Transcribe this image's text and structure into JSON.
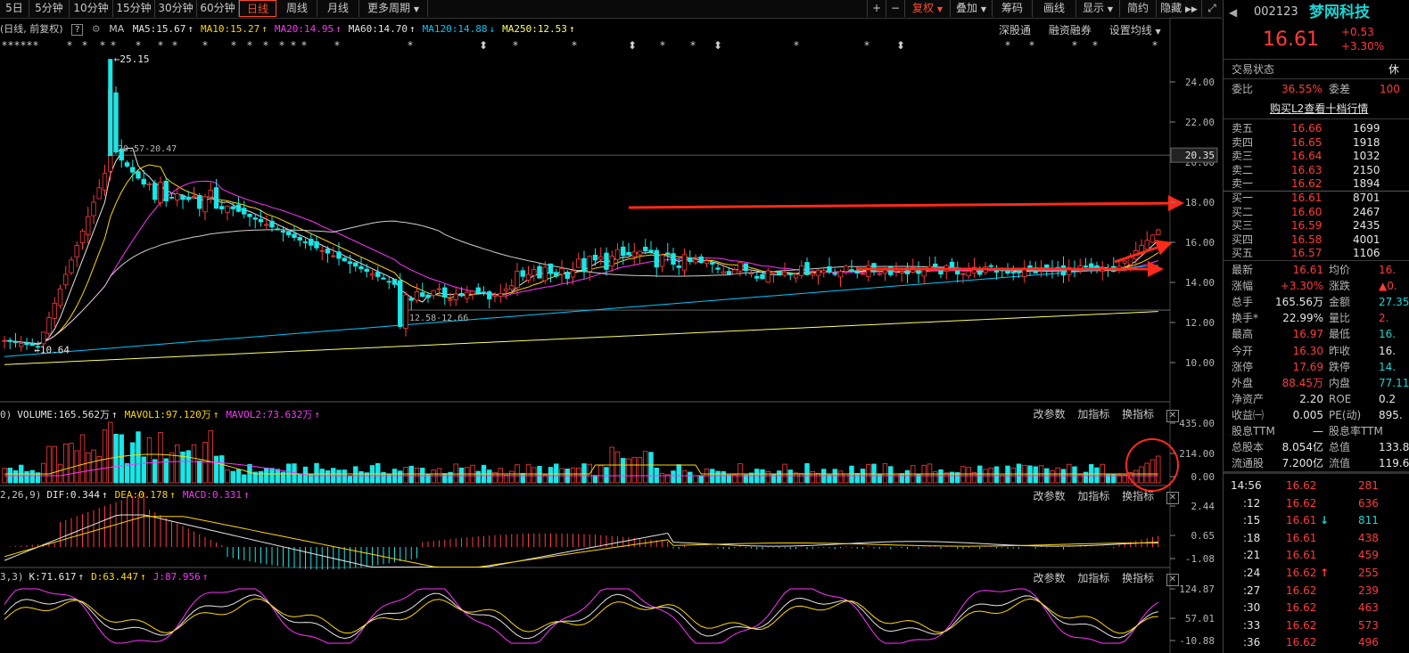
{
  "toolbar": {
    "periods": [
      "5日",
      "5分钟",
      "10分钟",
      "15分钟",
      "30分钟",
      "60分钟",
      "日线",
      "周线",
      "月线",
      "更多周期"
    ],
    "active_period": "日线",
    "right_buttons": [
      "+",
      "−",
      "复权",
      "叠加",
      "筹码",
      "画线",
      "显示",
      "简约",
      "隐藏"
    ]
  },
  "main_chart": {
    "header": "(日线, 前复权)",
    "ma_label": "MA",
    "ma": [
      {
        "text": "MA5:15.67",
        "color": "#e6e6e6",
        "arrow": "↑"
      },
      {
        "text": "MA10:15.27",
        "color": "#ffd700",
        "arrow": "↑"
      },
      {
        "text": "MA20:14.95",
        "color": "#ff33ff",
        "arrow": "↑"
      },
      {
        "text": "MA60:14.70",
        "color": "#e6e6e6",
        "arrow": "↑"
      },
      {
        "text": "MA120:14.88",
        "color": "#00c8ff",
        "arrow": "↓"
      },
      {
        "text": "MA250:12.53",
        "color": "#ffff66",
        "arrow": "↑"
      }
    ],
    "links": [
      "深股通",
      "融资融券",
      "设置均线"
    ],
    "y_ticks": [
      "24.00",
      "22.00",
      "20.00",
      "18.00",
      "16.00",
      "14.00",
      "12.00",
      "10.00"
    ],
    "ref_price": "20.35",
    "annotations": {
      "high": "←25.15",
      "low": "←10.64",
      "range1": "20.57-20.47",
      "range2": "12.58-12.66"
    }
  },
  "volume_panel": {
    "prefix": "0)",
    "items": [
      {
        "text": "VOLUME:165.562万",
        "color": "#e6e6e6",
        "arrow": "↑"
      },
      {
        "text": "MAVOL1:97.120万",
        "color": "#ffd700",
        "arrow": "↑"
      },
      {
        "text": "MAVOL2:73.632万",
        "color": "#ff33ff",
        "arrow": "↑"
      }
    ],
    "y_ticks": [
      "435.00",
      "214.00",
      "0.00"
    ]
  },
  "macd_panel": {
    "prefix": "2,26,9)",
    "items": [
      {
        "text": "DIF:0.344",
        "color": "#e6e6e6",
        "arrow": "↑"
      },
      {
        "text": "DEA:0.178",
        "color": "#ffd700",
        "arrow": "↑"
      },
      {
        "text": "MACD:0.331",
        "color": "#ff33ff",
        "arrow": "↑"
      }
    ],
    "y_ticks": [
      "2.44",
      "0.65",
      "-1.08"
    ]
  },
  "kdj_panel": {
    "prefix": "3,3)",
    "items": [
      {
        "text": "K:71.617",
        "color": "#e6e6e6",
        "arrow": "↑"
      },
      {
        "text": "D:63.447",
        "color": "#ffd700",
        "arrow": "↑"
      },
      {
        "text": "J:87.956",
        "color": "#ff33ff",
        "arrow": "↑"
      }
    ],
    "y_ticks": [
      "124.87",
      "57.01",
      "-10.88"
    ]
  },
  "panel_buttons": [
    "改参数",
    "加指标",
    "换指标"
  ],
  "stock": {
    "code": "002123",
    "name": "梦网科技",
    "price": "16.61",
    "change": "+0.53",
    "change_pct": "+3.30%"
  },
  "trade_status": {
    "label": "交易状态",
    "value": "休"
  },
  "weibi": {
    "label1": "委比",
    "value1": "36.55%",
    "label2": "委差",
    "value2": "100"
  },
  "l2_link": "购买L2查看十档行情",
  "sell_orders": [
    {
      "label": "卖五",
      "price": "16.66",
      "vol": "1699"
    },
    {
      "label": "卖四",
      "price": "16.65",
      "vol": "1918"
    },
    {
      "label": "卖三",
      "price": "16.64",
      "vol": "1032"
    },
    {
      "label": "卖二",
      "price": "16.63",
      "vol": "2150"
    },
    {
      "label": "卖一",
      "price": "16.62",
      "vol": "1894"
    }
  ],
  "buy_orders": [
    {
      "label": "买一",
      "price": "16.61",
      "vol": "8701"
    },
    {
      "label": "买二",
      "price": "16.60",
      "vol": "2467"
    },
    {
      "label": "买三",
      "price": "16.59",
      "vol": "2435"
    },
    {
      "label": "买四",
      "price": "16.58",
      "vol": "4001"
    },
    {
      "label": "买五",
      "price": "16.57",
      "vol": "1106"
    }
  ],
  "stats": [
    {
      "l1": "最新",
      "v1": "16.61",
      "c1": "red",
      "l2": "均价",
      "v2": "16.",
      "c2": "red"
    },
    {
      "l1": "涨幅",
      "v1": "+3.30%",
      "c1": "red",
      "l2": "涨跌",
      "v2": "▲0.",
      "c2": "red"
    },
    {
      "l1": "总手",
      "v1": "165.56万",
      "c1": "white",
      "l2": "金额",
      "v2": "27.35",
      "c2": "green"
    },
    {
      "l1": "换手*",
      "v1": "22.99%",
      "c1": "white",
      "l2": "量比",
      "v2": "2.",
      "c2": "red"
    },
    {
      "l1": "最高",
      "v1": "16.97",
      "c1": "red",
      "l2": "最低",
      "v2": "16.",
      "c2": "green"
    },
    {
      "l1": "今开",
      "v1": "16.30",
      "c1": "red",
      "l2": "昨收",
      "v2": "16.",
      "c2": "white"
    },
    {
      "l1": "涨停",
      "v1": "17.69",
      "c1": "red",
      "l2": "跌停",
      "v2": "14.",
      "c2": "green"
    },
    {
      "l1": "外盘",
      "v1": "88.45万",
      "c1": "red",
      "l2": "内盘",
      "v2": "77.11",
      "c2": "green"
    },
    {
      "l1": "净资产",
      "v1": "2.20",
      "c1": "white",
      "l2": "ROE",
      "v2": "0.2",
      "c2": "white"
    },
    {
      "l1": "收益㈠",
      "v1": "0.005",
      "c1": "white",
      "l2": "PE(动)",
      "v2": "895.",
      "c2": "white"
    },
    {
      "l1": "股息TTM",
      "v1": "—",
      "c1": "white",
      "l2": "股息率TTM",
      "v2": "",
      "c2": "white"
    },
    {
      "l1": "总股本",
      "v1": "8.054亿",
      "c1": "white",
      "l2": "总值",
      "v2": "133.8",
      "c2": "white"
    },
    {
      "l1": "流通股",
      "v1": "7.200亿",
      "c1": "white",
      "l2": "流值",
      "v2": "119.6",
      "c2": "white"
    }
  ],
  "ticks": [
    {
      "time": "14:56",
      "price": "16.62",
      "vol": "281",
      "arrow": "",
      "vc": "red"
    },
    {
      "time": ":12",
      "price": "16.62",
      "vol": "636",
      "arrow": "",
      "vc": "red"
    },
    {
      "time": ":15",
      "price": "16.61",
      "vol": "811",
      "arrow": "↓",
      "vc": "green"
    },
    {
      "time": ":18",
      "price": "16.61",
      "vol": "438",
      "arrow": "",
      "vc": "red"
    },
    {
      "time": ":21",
      "price": "16.61",
      "vol": "459",
      "arrow": "",
      "vc": "red"
    },
    {
      "time": ":24",
      "price": "16.62",
      "vol": "255",
      "arrow": "↑",
      "vc": "red"
    },
    {
      "time": ":27",
      "price": "16.62",
      "vol": "239",
      "arrow": "",
      "vc": "red"
    },
    {
      "time": ":30",
      "price": "16.62",
      "vol": "463",
      "arrow": "",
      "vc": "red"
    },
    {
      "time": ":33",
      "price": "16.62",
      "vol": "573",
      "arrow": "",
      "vc": "red"
    },
    {
      "time": ":36",
      "price": "16.62",
      "vol": "496",
      "arrow": "",
      "vc": "red"
    }
  ]
}
